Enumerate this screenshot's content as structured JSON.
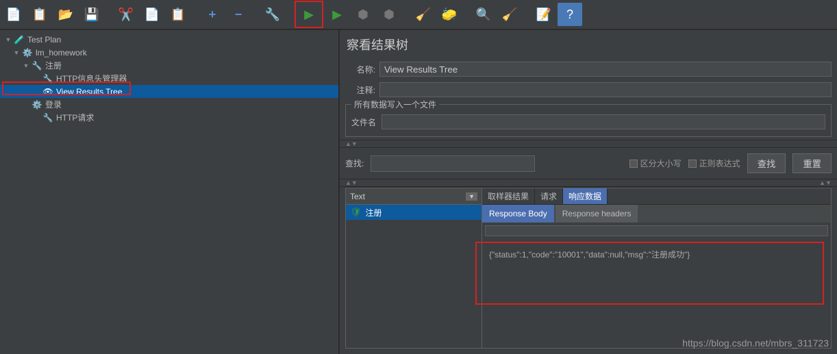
{
  "tree": {
    "items": [
      {
        "label": "Test Plan",
        "indent": 6,
        "icon": "flask",
        "toggle": "▼"
      },
      {
        "label": "lm_homework",
        "indent": 18,
        "icon": "gear",
        "toggle": "▼"
      },
      {
        "label": "注册",
        "indent": 32,
        "icon": "wrench",
        "toggle": "▼"
      },
      {
        "label": "HTTP信息头管理器",
        "indent": 48,
        "icon": "wrench",
        "toggle": ""
      },
      {
        "label": "View Results Tree",
        "indent": 48,
        "icon": "eye",
        "toggle": "",
        "selected": true
      },
      {
        "label": "登录",
        "indent": 32,
        "icon": "gear",
        "toggle": ""
      },
      {
        "label": "HTTP请求",
        "indent": 48,
        "icon": "wrench",
        "toggle": ""
      }
    ]
  },
  "panel": {
    "title": "察看结果树",
    "name_label": "名称:",
    "name_value": "View Results Tree",
    "comment_label": "注释:",
    "fieldset_legend": "所有数据写入一个文件",
    "file_label": "文件名"
  },
  "search": {
    "label": "查找:",
    "case_label": "区分大小写",
    "regex_label": "正则表达式",
    "find_btn": "查找",
    "reset_btn": "重置"
  },
  "results": {
    "combo": "Text",
    "item": "注册",
    "tabs1": [
      "取样器结果",
      "请求",
      "响应数据"
    ],
    "tabs2": [
      "Response Body",
      "Response headers"
    ],
    "body": "{\"status\":1,\"code\":\"10001\",\"data\":null,\"msg\":\"注册成功\"}"
  },
  "watermark": "https://blog.csdn.net/mbrs_311723"
}
